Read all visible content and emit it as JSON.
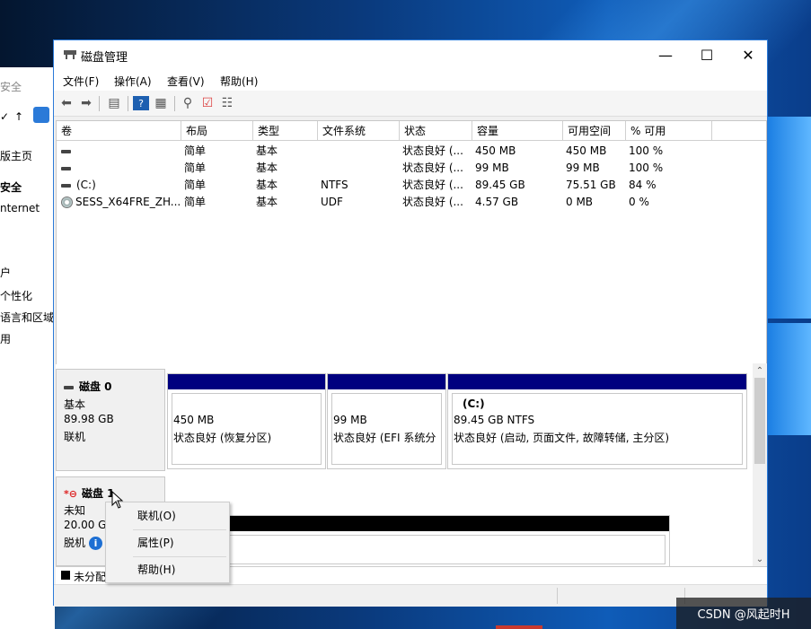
{
  "background_window": {
    "items": [
      "安全",
      "↑",
      "版主页",
      "安全",
      "nternet",
      "户",
      "个性化",
      "语言和区域",
      "用"
    ]
  },
  "window": {
    "title": "磁盘管理",
    "controls": {
      "minimize": "—",
      "maximize": "☐",
      "close": "✕"
    }
  },
  "menu": [
    "文件(F)",
    "操作(A)",
    "查看(V)",
    "帮助(H)"
  ],
  "volume_table": {
    "columns": [
      "卷",
      "布局",
      "类型",
      "文件系统",
      "状态",
      "容量",
      "可用空间",
      "% 可用"
    ],
    "rows": [
      {
        "volume": "",
        "layout": "简单",
        "type": "基本",
        "fs": "",
        "status": "状态良好 (...",
        "capacity": "450 MB",
        "free": "450 MB",
        "pct": "100 %"
      },
      {
        "volume": "",
        "layout": "简单",
        "type": "基本",
        "fs": "",
        "status": "状态良好 (...",
        "capacity": "99 MB",
        "free": "99 MB",
        "pct": "100 %"
      },
      {
        "volume": "(C:)",
        "layout": "简单",
        "type": "基本",
        "fs": "NTFS",
        "status": "状态良好 (...",
        "capacity": "89.45 GB",
        "free": "75.51 GB",
        "pct": "84 %"
      },
      {
        "volume": "SESS_X64FRE_ZH...",
        "layout": "简单",
        "type": "基本",
        "fs": "UDF",
        "status": "状态良好 (...",
        "capacity": "4.57 GB",
        "free": "0 MB",
        "pct": "0 %"
      }
    ]
  },
  "disk0": {
    "name": "磁盘 0",
    "kind": "基本",
    "size": "89.98 GB",
    "state": "联机",
    "partitions": [
      {
        "title": "",
        "size": "450 MB",
        "status": "状态良好 (恢复分区)"
      },
      {
        "title": "",
        "size": "99 MB",
        "status": "状态良好 (EFI 系统分"
      },
      {
        "title": "(C:)",
        "size": "89.45 GB NTFS",
        "status": "状态良好 (启动, 页面文件, 故障转储, 主分区)"
      }
    ]
  },
  "disk1": {
    "name": "磁盘 1",
    "kind": "未知",
    "size": "20.00 G",
    "state": "脱机"
  },
  "legend": {
    "unallocated": "未分配"
  },
  "context_menu": [
    "联机(O)",
    "属性(P)",
    "帮助(H)"
  ],
  "watermark": "CSDN @风起时H",
  "colors": {
    "partition_bar": "#00007f",
    "accent": "#2b7ad8"
  }
}
